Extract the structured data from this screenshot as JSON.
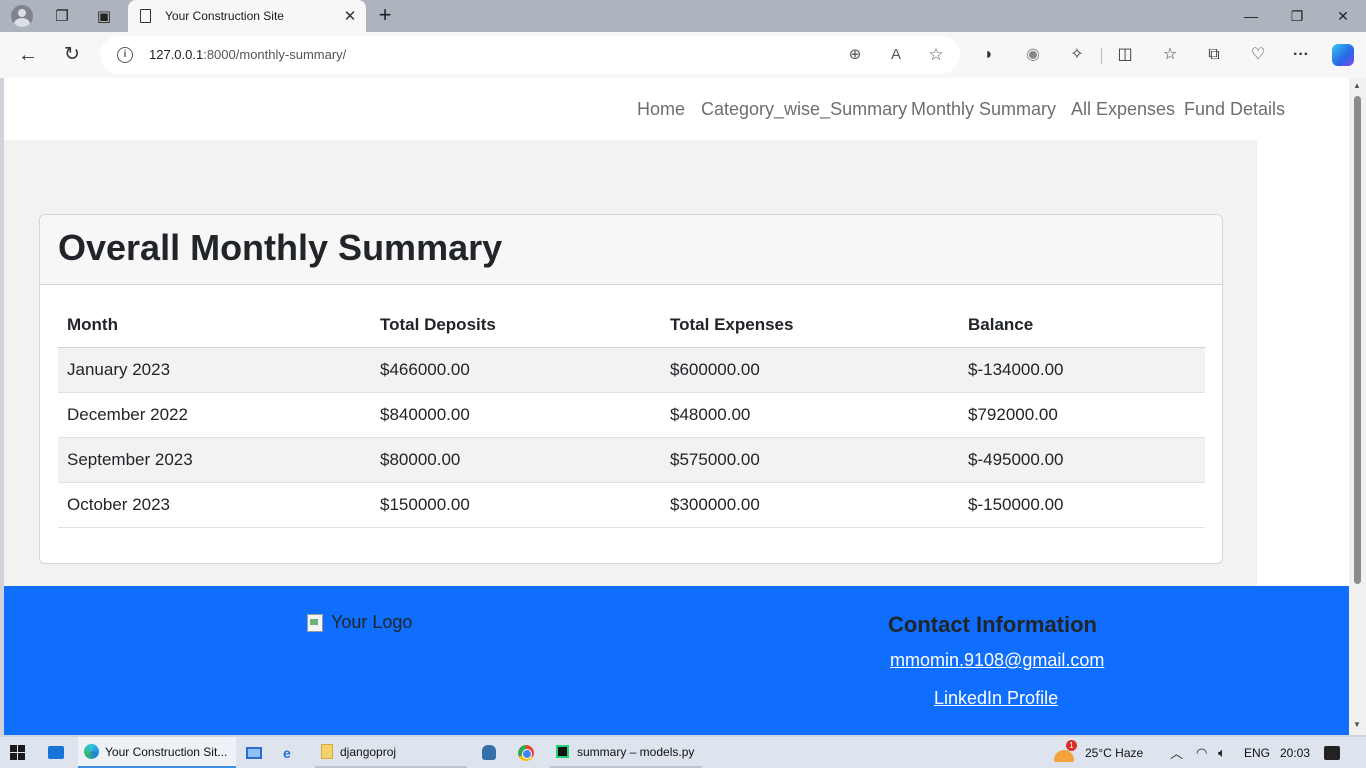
{
  "browser": {
    "tab_title": "Your Construction Site",
    "url_host": "127.0.0.1",
    "url_path": ":8000/monthly-summary/"
  },
  "nav": {
    "home": "Home",
    "category": "Category_wise_Summary",
    "monthly": "Monthly Summary",
    "all_expenses": "All Expenses",
    "fund_details": "Fund Details"
  },
  "card": {
    "title": "Overall Monthly Summary"
  },
  "table": {
    "headers": [
      "Month",
      "Total Deposits",
      "Total Expenses",
      "Balance"
    ],
    "rows": [
      [
        "January 2023",
        "$466000.00",
        "$600000.00",
        "$-134000.00"
      ],
      [
        "December 2022",
        "$840000.00",
        "$48000.00",
        "$792000.00"
      ],
      [
        "September 2023",
        "$80000.00",
        "$575000.00",
        "$-495000.00"
      ],
      [
        "October 2023",
        "$150000.00",
        "$300000.00",
        "$-150000.00"
      ]
    ]
  },
  "footer": {
    "logo_alt": "Your Logo",
    "contact_heading": "Contact Information",
    "email": "mmomin.9108@gmail.com",
    "linkedin": "LinkedIn Profile",
    "color": "#0f6efd"
  },
  "taskbar": {
    "edge_task": "Your Construction Sit...",
    "folder_task": "djangoproj",
    "pycharm_task": "summary – models.py",
    "weather_badge": "1",
    "weather": "25°C  Haze",
    "lang": "ENG",
    "time": "20:03"
  }
}
